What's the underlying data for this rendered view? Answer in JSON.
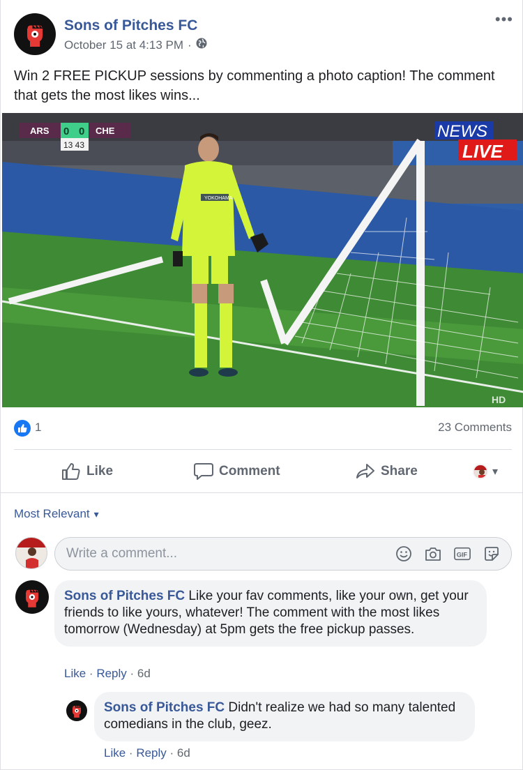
{
  "post": {
    "page_name": "Sons of Pitches FC",
    "timestamp": "October 15 at 4:13 PM",
    "separator": "·",
    "privacy_icon": "globe-icon",
    "more_icon": "•••",
    "text": "Win 2 FREE PICKUP sessions by commenting a photo caption! The comment that gets the most likes wins..."
  },
  "photo": {
    "scoreboard": {
      "home": "ARS",
      "home_score": "0",
      "away_score": "0",
      "away": "CHE",
      "clock": "13 43"
    },
    "news_label": "NEWS",
    "live_label": "LIVE",
    "sponsor_text": "YOKOHAMA",
    "corner_text": "HD"
  },
  "stats": {
    "likes": "1",
    "comments": "23 Comments"
  },
  "actions": {
    "like": "Like",
    "comment": "Comment",
    "share": "Share",
    "audience_caret": "▾"
  },
  "sort": {
    "label": "Most Relevant",
    "caret": "▾"
  },
  "composer": {
    "placeholder": "Write a comment...",
    "icons": [
      "emoji-icon",
      "camera-icon",
      "gif-icon",
      "sticker-icon"
    ],
    "gif_label": "GIF"
  },
  "comments": [
    {
      "author": "Sons of Pitches FC",
      "text": "Like your fav comments, like your own, get your friends to like yours, whatever! The comment with the most likes tomorrow (Wednesday) at 5pm gets the free pickup passes.",
      "like": "Like",
      "reply": "Reply",
      "age": "6d"
    },
    {
      "author": "Sons of Pitches FC",
      "text": "Didn't realize we had so many talented comedians in the club, geez.",
      "like": "Like",
      "reply": "Reply",
      "age": "6d"
    }
  ],
  "colors": {
    "link": "#385898",
    "secondary_text": "#606770",
    "bubble": "#f2f3f5",
    "like_blue": "#1877f2",
    "fist_red": "#e53935"
  }
}
